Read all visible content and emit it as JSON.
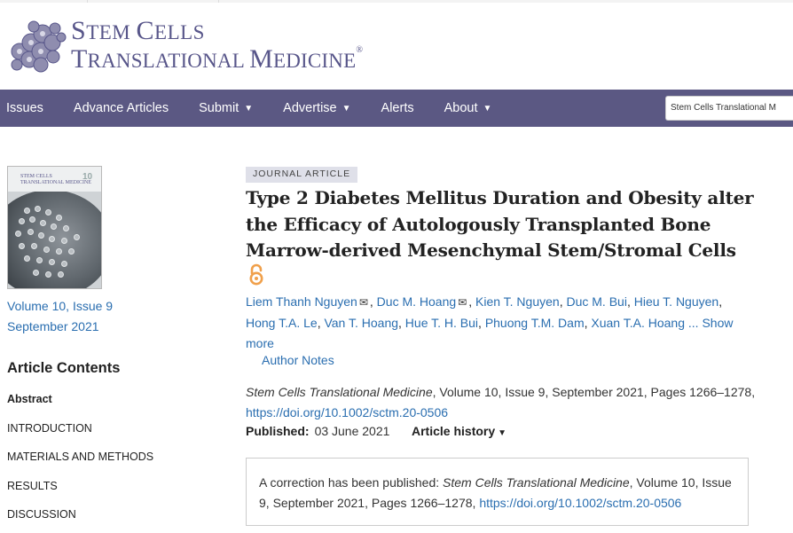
{
  "site": {
    "logo_line1_a": "S",
    "logo_line1_b": "TEM ",
    "logo_line1_c": "C",
    "logo_line1_d": "ELLS",
    "logo_line2_a": "T",
    "logo_line2_b": "RANSLATIONAL ",
    "logo_line2_c": "M",
    "logo_line2_d": "EDICINE",
    "logo_mark": "®",
    "brand_color": "#5b5883"
  },
  "nav": {
    "items": [
      {
        "label": "Issues",
        "caret": ""
      },
      {
        "label": "Advance Articles",
        "caret": ""
      },
      {
        "label": "Submit",
        "caret": "▼"
      },
      {
        "label": "Advertise",
        "caret": "▼"
      },
      {
        "label": "Alerts",
        "caret": ""
      },
      {
        "label": "About",
        "caret": "▼"
      }
    ],
    "site_select_value": "Stem Cells Translational M"
  },
  "sidebar": {
    "cover_title_1": "STEM CELLS",
    "cover_title_2": "TRANSLATIONAL MEDICINE",
    "cover_badge": "10",
    "issue_line1": "Volume 10, Issue 9",
    "issue_line2": "September 2021",
    "contents_title": "Article Contents",
    "toc": [
      {
        "label": "Abstract",
        "active": true
      },
      {
        "label": "INTRODUCTION",
        "active": false
      },
      {
        "label": "MATERIALS AND METHODS",
        "active": false
      },
      {
        "label": "RESULTS",
        "active": false
      },
      {
        "label": "DISCUSSION",
        "active": false
      }
    ]
  },
  "article": {
    "type_label": "JOURNAL ARTICLE",
    "title": "Type 2 Diabetes Mellitus Duration and Obesity alter the Efficacy of Autologously Transplanted Bone Marrow-derived Mesenchymal Stem/Stromal Cells",
    "open_access_icon": "open-access-icon",
    "authors": [
      {
        "name": "Liem Thanh Nguyen",
        "corresponding": true
      },
      {
        "name": "Duc M. Hoang",
        "corresponding": true
      },
      {
        "name": "Kien T. Nguyen",
        "corresponding": false
      },
      {
        "name": "Duc M. Bui",
        "corresponding": false
      },
      {
        "name": "Hieu T. Nguyen",
        "corresponding": false
      },
      {
        "name": "Hong T.A. Le",
        "corresponding": false
      },
      {
        "name": "Van T. Hoang",
        "corresponding": false
      },
      {
        "name": "Hue T. H. Bui",
        "corresponding": false
      },
      {
        "name": "Phuong T.M. Dam",
        "corresponding": false
      },
      {
        "name": "Xuan T.A. Hoang",
        "corresponding": false
      }
    ],
    "show_more": "... Show more",
    "author_notes": "Author Notes",
    "citation_journal": "Stem Cells Translational Medicine",
    "citation_rest": ", Volume 10, Issue 9, September 2021, Pages 1266–1278,",
    "doi": "https://doi.org/10.1002/sctm.20-0506",
    "published_label": "Published:",
    "published_date": "03 June 2021",
    "history_label": "Article history",
    "history_caret": "▼"
  },
  "correction": {
    "prefix": "A correction has been published: ",
    "journal": "Stem Cells Translational Medicine",
    "rest": ", Volume 10, Issue 9, September 2021, Pages 1266–1278, ",
    "doi": "https://doi.org/10.1002/sctm.20-0506"
  }
}
